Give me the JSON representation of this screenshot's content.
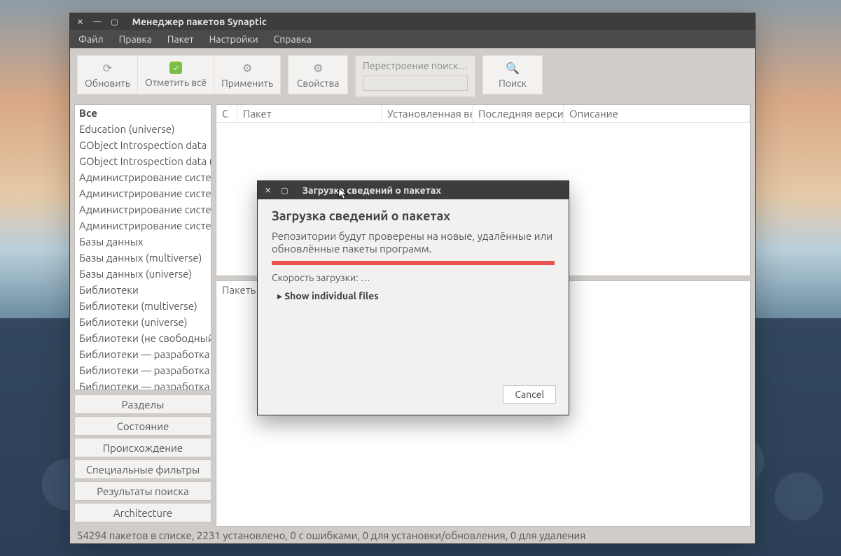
{
  "window": {
    "title": "Менеджер пакетов Synaptic"
  },
  "menu": {
    "file": "Файл",
    "edit": "Правка",
    "package": "Пакет",
    "settings": "Настройки",
    "help": "Справка"
  },
  "toolbar": {
    "reload": "Обновить",
    "mark_all": "Отметить всё",
    "apply": "Применить",
    "properties": "Свойства",
    "search_rebuild": "Перестроение поиск…",
    "search": "Поиск"
  },
  "categories": [
    "Все",
    "Education (universe)",
    "GObject Introspection data",
    "GObject Introspection data (",
    "Администрирование систем",
    "Администрирование систем",
    "Администрирование систем",
    "Администрирование систем",
    "Базы данных",
    "Базы данных (multiverse)",
    "Базы данных (universe)",
    "Библиотеки",
    "Библиотеки (multiverse)",
    "Библиотеки (universe)",
    "Библиотеки (не свободный",
    "Библиотеки — разработка",
    "Библиотеки — разработка (",
    "Библиотеки — разработка ("
  ],
  "filters": {
    "sections": "Разделы",
    "status": "Состояние",
    "origin": "Происхождение",
    "custom": "Специальные фильтры",
    "search_results": "Результаты поиска",
    "architecture": "Architecture"
  },
  "table": {
    "col_status": "С",
    "col_package": "Пакет",
    "col_installed": "Установленная ве",
    "col_latest": "Последняя верси",
    "col_description": "Описание"
  },
  "bottompanel_label": "Пакеть",
  "statusbar": "54294 пакетов в списке, 2231 установлено, 0 с ошибками, 0 для установки/обновления, 0 для удаления",
  "dialog": {
    "title": "Загрузка сведений о пакетах",
    "heading": "Загрузка сведений о пакетах",
    "message": "Репозитории будут проверены на новые, удалённые или обновлённые пакеты программ.",
    "speed": "Скорость загрузки: …",
    "expand": "Show individual files",
    "cancel": "Cancel"
  }
}
